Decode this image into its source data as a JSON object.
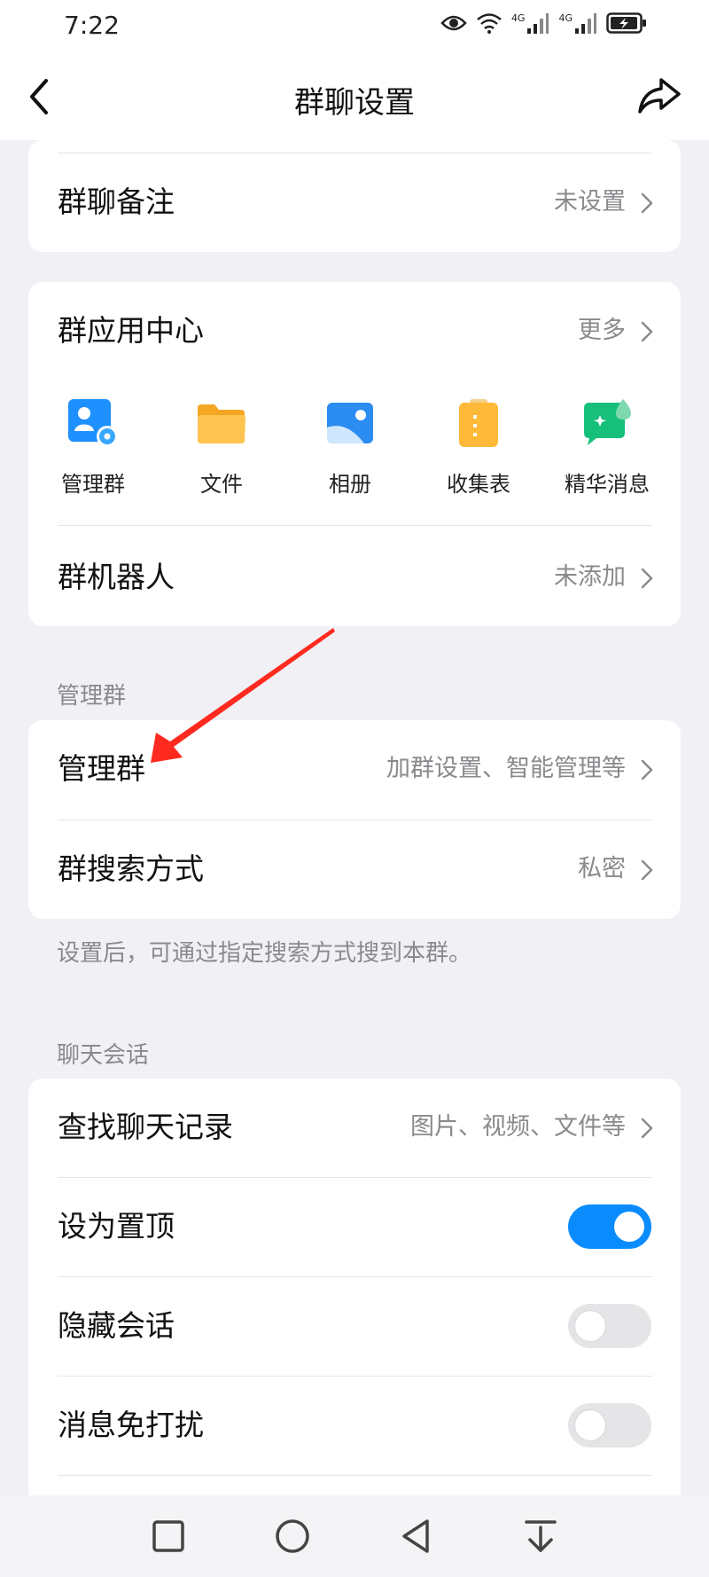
{
  "status": {
    "time": "7:22",
    "network_label_1": "4G",
    "network_label_2": "4G"
  },
  "nav": {
    "title": "群聊设置"
  },
  "group_remark": {
    "label": "群聊备注",
    "value": "未设置"
  },
  "apps": {
    "title": "群应用中心",
    "more": "更多",
    "items": [
      {
        "label": "管理群",
        "icon": "admin-group-icon",
        "color": "#1e90ff"
      },
      {
        "label": "文件",
        "icon": "folder-icon",
        "color": "#ffb938"
      },
      {
        "label": "相册",
        "icon": "photo-album-icon",
        "color": "#2b8cf2"
      },
      {
        "label": "收集表",
        "icon": "clipboard-icon",
        "color": "#ffb938"
      },
      {
        "label": "精华消息",
        "icon": "highlight-message-icon",
        "color": "#16c07a"
      }
    ],
    "bot": {
      "label": "群机器人",
      "value": "未添加"
    }
  },
  "manage_section": {
    "header": "管理群",
    "items": [
      {
        "label": "管理群",
        "value": "加群设置、智能管理等"
      },
      {
        "label": "群搜索方式",
        "value": "私密"
      }
    ],
    "hint": "设置后，可通过指定搜索方式搜到本群。"
  },
  "chat_section": {
    "header": "聊天会话",
    "search_history": {
      "label": "查找聊天记录",
      "value": "图片、视频、文件等"
    },
    "toggles": [
      {
        "label": "设为置顶",
        "on": true
      },
      {
        "label": "隐藏会话",
        "on": false
      },
      {
        "label": "消息免打扰",
        "on": false
      }
    ]
  },
  "colors": {
    "accent": "#0a8cff",
    "annotation_arrow": "#ff2a1f",
    "background": "#f0f0f5"
  }
}
